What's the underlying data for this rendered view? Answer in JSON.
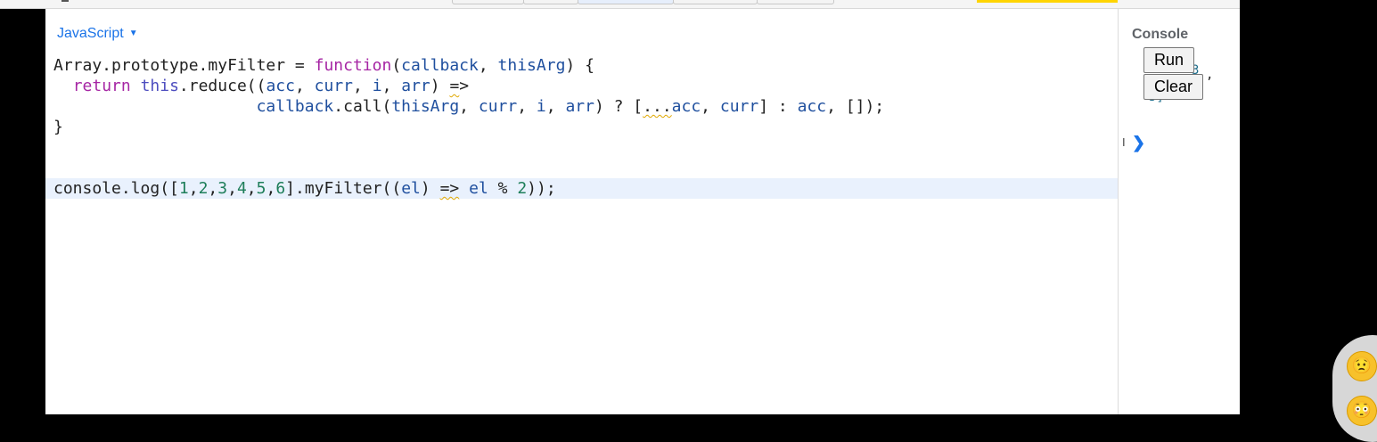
{
  "editor": {
    "language": "JavaScript",
    "lines": [
      "Array.prototype.myFilter = function(callback, thisArg) {",
      "  return this.reduce((acc, curr, i, arr) =>",
      "                     callback.call(thisArg, curr, i, arr) ? [...acc, curr] : acc, []);",
      "}",
      "",
      "",
      "console.log([1,2,3,4,5,6].myFilter((el) => el % 2));"
    ]
  },
  "console": {
    "title": "Console",
    "run_label": "Run",
    "clear_label": "Clear",
    "prompt": "❯",
    "output_fragments": [
      "3",
      ",",
      "5]"
    ]
  },
  "reactions": [
    "😟",
    "😳"
  ]
}
